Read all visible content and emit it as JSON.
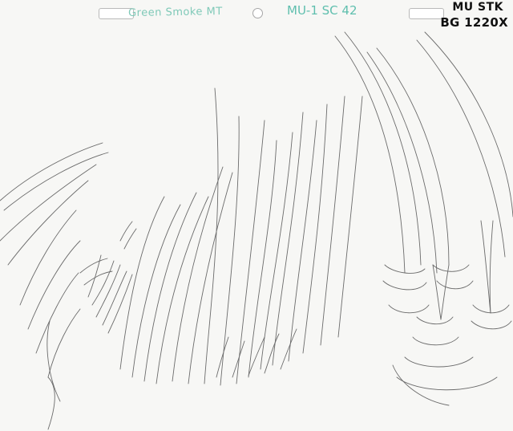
{
  "sheet": {
    "title_note": "Green Smoke MT",
    "scene_note": "MU-1 SC 42",
    "stock_note": "MU STK",
    "bg_note": "BG 1220X",
    "paper_color": "#f7f7f5",
    "pencil_color": "#6b6b6b",
    "ink_title_color": "#7fc9b8"
  }
}
